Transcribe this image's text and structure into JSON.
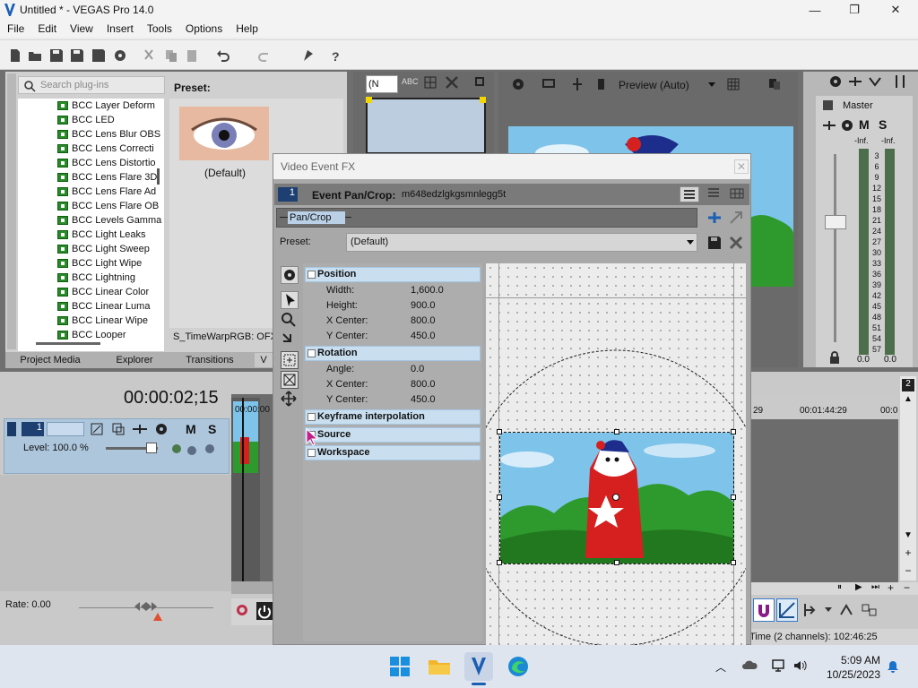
{
  "window": {
    "title": "Untitled * - VEGAS Pro 14.0"
  },
  "menu": [
    "File",
    "Edit",
    "View",
    "Insert",
    "Tools",
    "Options",
    "Help"
  ],
  "plugins": {
    "search_placeholder": "Search plug-ins",
    "preset_label": "Preset:",
    "preset_default": "(Default)",
    "status": "S_TimeWarpRGB: OFX,",
    "items": [
      "BCC Layer Deform",
      "BCC LED",
      "BCC Lens Blur OBS",
      "BCC Lens Correcti",
      "BCC Lens Distortio",
      "BCC Lens Flare 3D",
      "BCC Lens Flare Ad",
      "BCC Lens Flare OB",
      "BCC Levels Gamma",
      "BCC Light Leaks",
      "BCC Light Sweep",
      "BCC Light Wipe",
      "BCC Lightning",
      "BCC Linear Color",
      "BCC Linear Luma",
      "BCC Linear Wipe",
      "BCC Looper"
    ]
  },
  "tabs": [
    "Project Media",
    "Explorer",
    "Transitions",
    "V"
  ],
  "trimmer": {
    "dropdown": "(N"
  },
  "preview": {
    "label": "Preview (Auto)"
  },
  "mixer": {
    "master": "Master",
    "m": "M",
    "s": "S",
    "inf1": "-Inf.",
    "inf2": "-Inf.",
    "scale": [
      "3",
      "6",
      "9",
      "12",
      "15",
      "18",
      "21",
      "24",
      "27",
      "30",
      "33",
      "36",
      "39",
      "42",
      "45",
      "48",
      "51",
      "54",
      "57"
    ],
    "bottom1": "0.0",
    "bottom2": "0.0"
  },
  "timeline": {
    "time": "00:00:02;15",
    "track_num": "1",
    "m": "M",
    "s": "S",
    "level": "Level: 100.0 %",
    "rate": "Rate: 0.00",
    "ruler_start": "00:00:00",
    "ruler_left": "29",
    "ruler_mid": "00:01:44:29",
    "ruler_right": "00:0",
    "status": "Time (2 channels): 102:46:25",
    "pos_marker": "2"
  },
  "dialog": {
    "title": "Video Event FX",
    "num": "1",
    "event_label": "Event Pan/Crop:",
    "event_name": "m648edzlgkgsmnlegg5t",
    "chain": "Pan/Crop",
    "preset_label": "Preset:",
    "preset_value": "(Default)",
    "sections": {
      "position": "Position",
      "rotation": "Rotation",
      "keyframe": "Keyframe interpolation",
      "source": "Source",
      "workspace": "Workspace"
    },
    "position": [
      {
        "k": "Width:",
        "v": "1,600.0"
      },
      {
        "k": "Height:",
        "v": "900.0"
      },
      {
        "k": "X Center:",
        "v": "800.0"
      },
      {
        "k": "Y Center:",
        "v": "450.0"
      }
    ],
    "rotation": [
      {
        "k": "Angle:",
        "v": "0.0"
      },
      {
        "k": "X Center:",
        "v": "800.0"
      },
      {
        "k": "Y Center:",
        "v": "450.0"
      }
    ]
  },
  "taskbar": {
    "time": "5:09 AM",
    "date": "10/25/2023"
  },
  "colors": {
    "accent": "#1a73c9",
    "sky": "#7ec3ea",
    "grass": "#2e9a2e",
    "shirt": "#d62020"
  }
}
